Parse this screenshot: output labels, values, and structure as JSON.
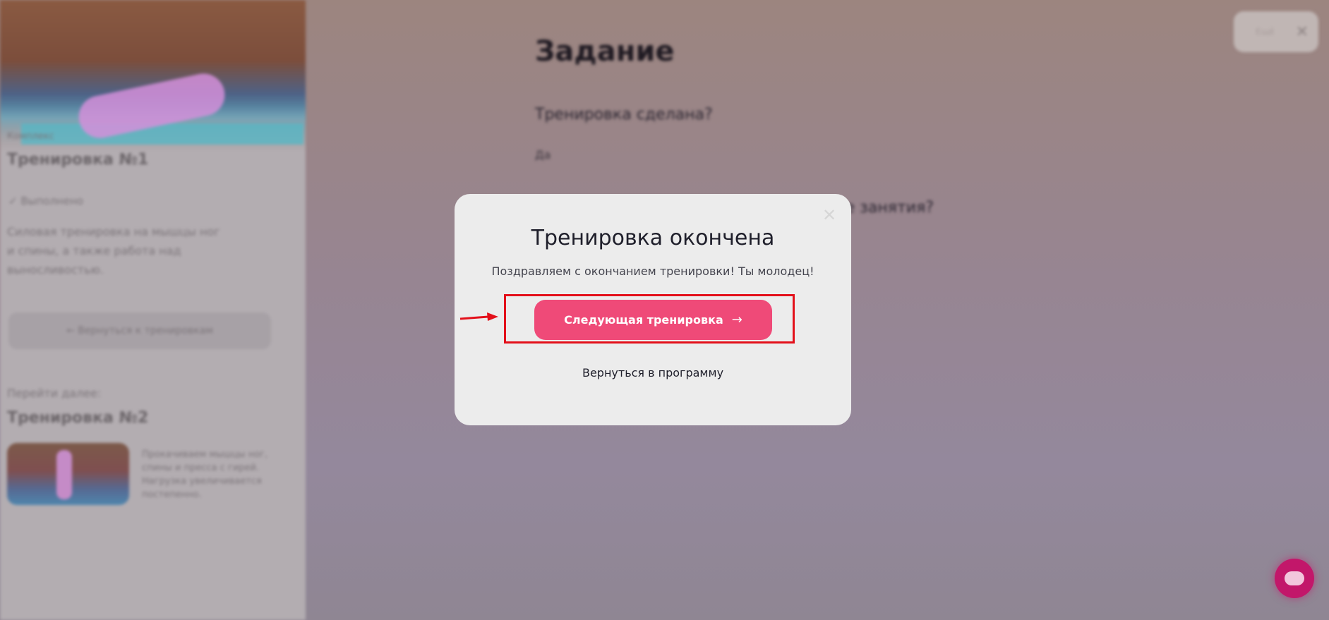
{
  "sidebar": {
    "hero_caption": "Комплекс",
    "workout_title": "Тренировка №1",
    "status_icon": "check-icon",
    "status_text": "✓  Выполнено",
    "description": "Силовая тренировка на мышцы ног и спины, а также работа над выносливостью.",
    "back_button_label": "←  Вернуться к тренировкам",
    "next_caption": "Перейти далее:",
    "next_title": "Тренировка №2",
    "next_description": "Прокачиваем мышцы ног, спины и пресса с гирей. Нагрузка увеличивается постепенно."
  },
  "main": {
    "title": "Задание",
    "question_1": "Тренировка сделана?",
    "answer_1": "Да",
    "question_2": "е занятия?"
  },
  "top_pill": {
    "text": "Ещё",
    "close_icon": "close-icon",
    "close_glyph": "✕"
  },
  "modal": {
    "close_glyph": "✕",
    "title": "Тренировка окончена",
    "message": "Поздравляем с окончанием тренировки! Ты молодец!",
    "next_button_label": "Следующая тренировка",
    "next_button_arrow": "→",
    "back_link_label": "Вернуться в программу"
  },
  "chat": {
    "icon": "chat-icon"
  },
  "colors": {
    "accent": "#ef4a78",
    "highlight": "#e3101a",
    "chat": "#c2176a"
  }
}
